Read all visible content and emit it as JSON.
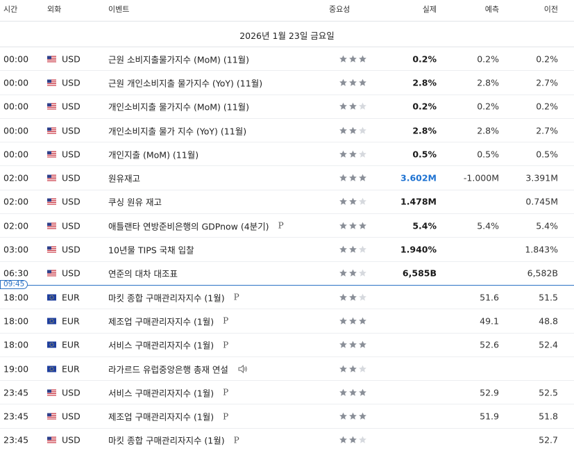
{
  "header": {
    "time": "시간",
    "currency": "외화",
    "event": "이벤트",
    "importance": "중요성",
    "actual": "실제",
    "forecast": "예측",
    "previous": "이전"
  },
  "date_label": "2026년 1월 23일 금요일",
  "now_marker": "09:45",
  "colors": {
    "accent": "#2a71c4",
    "actual_highlight": "#1f73d2",
    "star_on": "#8a8f98",
    "star_off": "#d6d9de"
  },
  "events": [
    {
      "time": "00:00",
      "flag": "us-flag-icon",
      "currency": "USD",
      "event": "근원 소비지출물가지수 (MoM) (11월)",
      "importance": 3,
      "actual": "0.2%",
      "forecast": "0.2%",
      "previous": "0.2%"
    },
    {
      "time": "00:00",
      "flag": "us-flag-icon",
      "currency": "USD",
      "event": "근원 개인소비지출 물가지수 (YoY) (11월)",
      "importance": 3,
      "actual": "2.8%",
      "forecast": "2.8%",
      "previous": "2.7%"
    },
    {
      "time": "00:00",
      "flag": "us-flag-icon",
      "currency": "USD",
      "event": "개인소비지출 물가지수 (MoM) (11월)",
      "importance": 2,
      "actual": "0.2%",
      "forecast": "0.2%",
      "previous": "0.2%"
    },
    {
      "time": "00:00",
      "flag": "us-flag-icon",
      "currency": "USD",
      "event": "개인소비지출 물가 지수 (YoY) (11월)",
      "importance": 2,
      "actual": "2.8%",
      "forecast": "2.8%",
      "previous": "2.7%"
    },
    {
      "time": "00:00",
      "flag": "us-flag-icon",
      "currency": "USD",
      "event": "개인지출 (MoM) (11월)",
      "importance": 2,
      "actual": "0.5%",
      "forecast": "0.5%",
      "previous": "0.5%"
    },
    {
      "time": "02:00",
      "flag": "us-flag-icon",
      "currency": "USD",
      "event": "원유재고",
      "importance": 3,
      "actual": "3.602M",
      "actual_highlight": true,
      "forecast": "-1.000M",
      "previous": "3.391M"
    },
    {
      "time": "02:00",
      "flag": "us-flag-icon",
      "currency": "USD",
      "event": "쿠싱 원유 재고",
      "importance": 2,
      "actual": "1.478M",
      "forecast": "",
      "previous": "0.745M"
    },
    {
      "time": "02:00",
      "flag": "us-flag-icon",
      "currency": "USD",
      "event": "애틀랜타 연방준비은행의 GDPnow (4분기)",
      "mark": "P",
      "importance": 3,
      "actual": "5.4%",
      "forecast": "5.4%",
      "previous": "5.4%"
    },
    {
      "time": "03:00",
      "flag": "us-flag-icon",
      "currency": "USD",
      "event": "10년물 TIPS 국채 입찰",
      "importance": 2,
      "actual": "1.940%",
      "forecast": "",
      "previous": "1.843%"
    },
    {
      "time": "06:30",
      "flag": "us-flag-icon",
      "currency": "USD",
      "event": "연준의 대차 대조표",
      "importance": 2,
      "actual": "6,585B",
      "forecast": "",
      "previous": "6,582B"
    },
    {
      "time": "18:00",
      "flag": "eu-flag-icon",
      "currency": "EUR",
      "event": "마킷 종합 구매관리자지수 (1월)",
      "mark": "P",
      "importance": 2,
      "actual": "",
      "forecast": "51.6",
      "previous": "51.5"
    },
    {
      "time": "18:00",
      "flag": "eu-flag-icon",
      "currency": "EUR",
      "event": "제조업 구매관리자지수 (1월)",
      "mark": "P",
      "importance": 3,
      "actual": "",
      "forecast": "49.1",
      "previous": "48.8"
    },
    {
      "time": "18:00",
      "flag": "eu-flag-icon",
      "currency": "EUR",
      "event": "서비스 구매관리자지수 (1월)",
      "mark": "P",
      "importance": 3,
      "actual": "",
      "forecast": "52.6",
      "previous": "52.4"
    },
    {
      "time": "19:00",
      "flag": "eu-flag-icon",
      "currency": "EUR",
      "event": "라가르드 유럽중앙은행 총재 연설",
      "speaker": true,
      "importance": 2,
      "actual": "",
      "forecast": "",
      "previous": ""
    },
    {
      "time": "23:45",
      "flag": "us-flag-icon",
      "currency": "USD",
      "event": "서비스 구매관리자지수 (1월)",
      "mark": "P",
      "importance": 3,
      "actual": "",
      "forecast": "52.9",
      "previous": "52.5"
    },
    {
      "time": "23:45",
      "flag": "us-flag-icon",
      "currency": "USD",
      "event": "제조업 구매관리자지수 (1월)",
      "mark": "P",
      "importance": 3,
      "actual": "",
      "forecast": "51.9",
      "previous": "51.8"
    },
    {
      "time": "23:45",
      "flag": "us-flag-icon",
      "currency": "USD",
      "event": "마킷 종합 구매관리자지수 (1월)",
      "mark": "P",
      "importance": 2,
      "actual": "",
      "forecast": "",
      "previous": "52.7"
    }
  ]
}
